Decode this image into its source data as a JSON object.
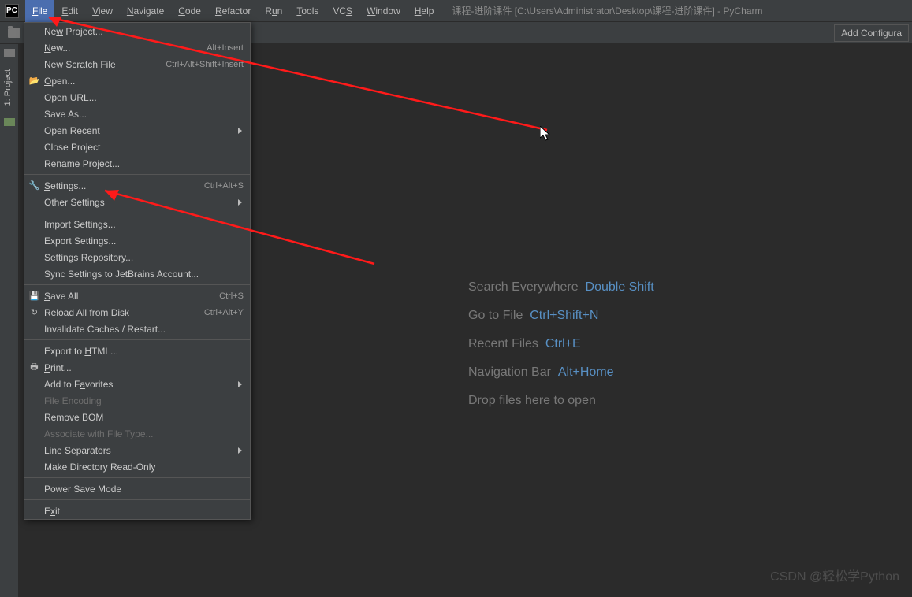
{
  "title": "课程-进阶课件 [C:\\Users\\Administrator\\Desktop\\课程-进阶课件] - PyCharm",
  "menubar": [
    "File",
    "Edit",
    "View",
    "Navigate",
    "Code",
    "Refactor",
    "Run",
    "Tools",
    "VCS",
    "Window",
    "Help"
  ],
  "toolbar": {
    "add_config": "Add Configura"
  },
  "left_tool": {
    "project_tab": "1: Project"
  },
  "dropdown": {
    "new_project": "New Project...",
    "new": "New...",
    "new_sc": "Alt+Insert",
    "new_scratch": "New Scratch File",
    "new_scratch_sc": "Ctrl+Alt+Shift+Insert",
    "open": "Open...",
    "open_url": "Open URL...",
    "save_as": "Save As...",
    "open_recent": "Open Recent",
    "close_project": "Close Project",
    "rename_project": "Rename Project...",
    "settings": "Settings...",
    "settings_sc": "Ctrl+Alt+S",
    "other_settings": "Other Settings",
    "import_settings": "Import Settings...",
    "export_settings": "Export Settings...",
    "settings_repo": "Settings Repository...",
    "sync_settings": "Sync Settings to JetBrains Account...",
    "save_all": "Save All",
    "save_all_sc": "Ctrl+S",
    "reload_all": "Reload All from Disk",
    "reload_all_sc": "Ctrl+Alt+Y",
    "invalidate": "Invalidate Caches / Restart...",
    "export_html": "Export to HTML...",
    "print": "Print...",
    "add_fav": "Add to Favorites",
    "file_encoding": "File Encoding",
    "remove_bom": "Remove BOM",
    "assoc_ft": "Associate with File Type...",
    "line_sep": "Line Separators",
    "make_ro": "Make Directory Read-Only",
    "power_save": "Power Save Mode",
    "exit": "Exit"
  },
  "welcome": {
    "search": "Search Everywhere",
    "search_k": "Double Shift",
    "goto": "Go to File",
    "goto_k": "Ctrl+Shift+N",
    "recent": "Recent Files",
    "recent_k": "Ctrl+E",
    "nav": "Navigation Bar",
    "nav_k": "Alt+Home",
    "drop": "Drop files here to open"
  },
  "watermark": "CSDN @轻松学Python"
}
